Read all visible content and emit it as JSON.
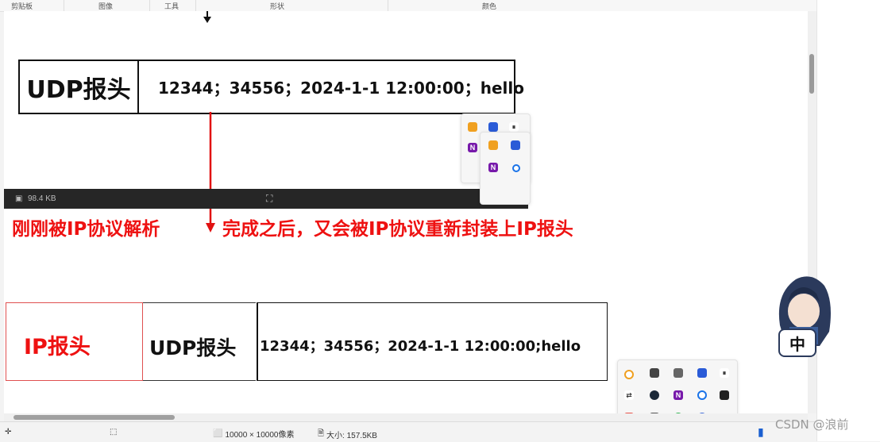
{
  "ribbon": {
    "groups": [
      "剪贴板",
      "图像",
      "工具",
      "形状",
      "颜色"
    ]
  },
  "top_packet": {
    "header_label": "UDP报头",
    "payload": "12344；34556；2024-1-1 12:00:00；hello"
  },
  "dark_bar": {
    "size_text": "98.4 KB"
  },
  "annotation": {
    "left_text": "刚刚被IP协议解析",
    "right_text": "完成之后，又会被IP协议重新封装上IP报头"
  },
  "bottom_packet": {
    "ip_label": "IP报头",
    "udp_label": "UDP报头",
    "payload": "12344；34556；2024-1-1 12:00:00;hello"
  },
  "status": {
    "dimensions": "10000 × 10000像素",
    "size": "大小: 157.5KB"
  },
  "ime": {
    "label": "中"
  },
  "watermark": {
    "text": "CSDN @浪前"
  },
  "colors": {
    "red": "#e11111",
    "ink": "#111111"
  }
}
